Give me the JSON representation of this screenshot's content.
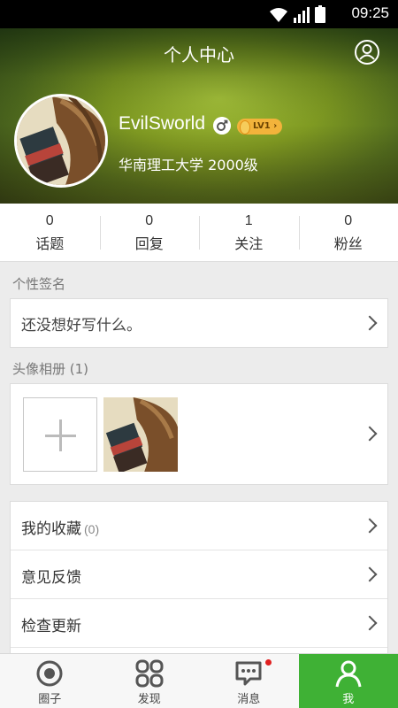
{
  "status_bar": {
    "time": "09:25",
    "icons": [
      "wifi-icon",
      "signal-icon",
      "battery-icon"
    ]
  },
  "header": {
    "title": "个人中心",
    "account_icon": "user-circle-icon"
  },
  "profile": {
    "name": "EvilSworld",
    "gender_icon": "male-icon",
    "level": "LV1",
    "school": "华南理工大学 2000级"
  },
  "stats": [
    {
      "value": "0",
      "label": "话题"
    },
    {
      "value": "0",
      "label": "回复"
    },
    {
      "value": "1",
      "label": "关注"
    },
    {
      "value": "0",
      "label": "粉丝"
    }
  ],
  "signature": {
    "section_label": "个性签名",
    "text": "还没想好写什么。"
  },
  "album": {
    "section_label": "头像相册 (1)"
  },
  "menu": [
    {
      "label": "我的收藏",
      "count": "(0)"
    },
    {
      "label": "意见反馈",
      "count": ""
    },
    {
      "label": "检查更新",
      "count": ""
    }
  ],
  "tabbar": {
    "tabs": [
      {
        "label": "圈子",
        "icon": "circle-target-icon"
      },
      {
        "label": "发现",
        "icon": "grid-icon"
      },
      {
        "label": "消息",
        "icon": "chat-bubble-icon"
      },
      {
        "label": "我",
        "icon": "person-icon"
      }
    ],
    "active_color": "#3fb135"
  },
  "colors": {
    "accent": "#3fb135",
    "badge": "#f3b33b",
    "notification_dot": "#e02020"
  }
}
